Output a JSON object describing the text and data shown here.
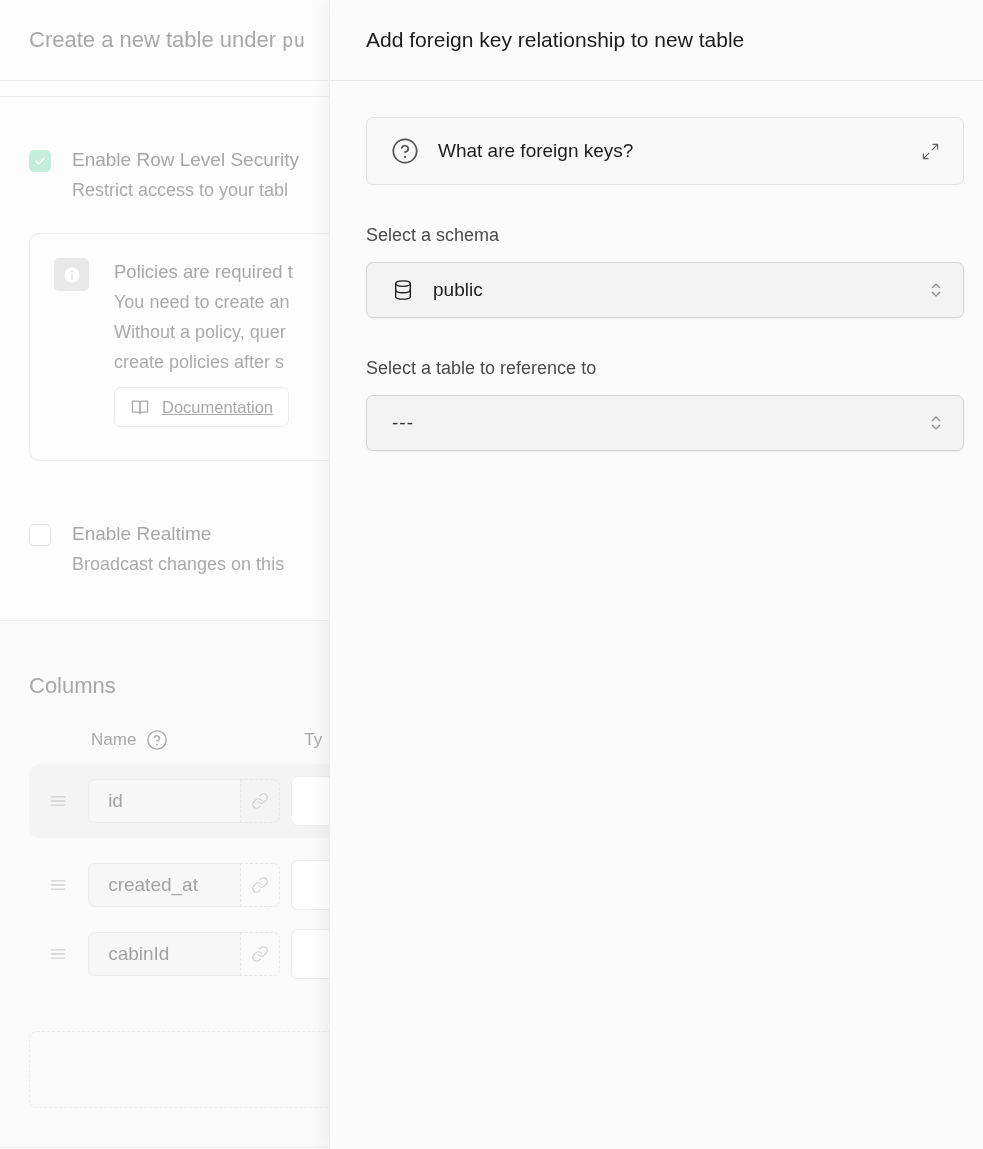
{
  "background_form": {
    "title": "Create a new table under",
    "schema": "pu",
    "rls": {
      "checked": true,
      "label": "Enable Row Level Security",
      "description": "Restrict access to your tabl"
    },
    "policy_notice": {
      "title": "Policies are required t",
      "body": [
        "You need to create an",
        "Without a policy, quer",
        "create policies after s"
      ],
      "link": "Documentation"
    },
    "realtime": {
      "checked": false,
      "label": "Enable Realtime",
      "description": "Broadcast changes on this"
    },
    "columns": {
      "title": "Columns",
      "headers": [
        "Name",
        "Ty"
      ],
      "rows": [
        {
          "name": "id",
          "highlighted": true
        },
        {
          "name": "created_at",
          "highlighted": false
        },
        {
          "name": "cabinId",
          "highlighted": false
        }
      ]
    }
  },
  "side_panel": {
    "title": "Add foreign key relationship to new table",
    "help": {
      "label": "What are foreign keys?"
    },
    "fields": [
      {
        "kind": "schema",
        "label": "Select a schema",
        "value": "public"
      },
      {
        "kind": "table",
        "label": "Select a table to reference to",
        "value": "---"
      }
    ]
  }
}
